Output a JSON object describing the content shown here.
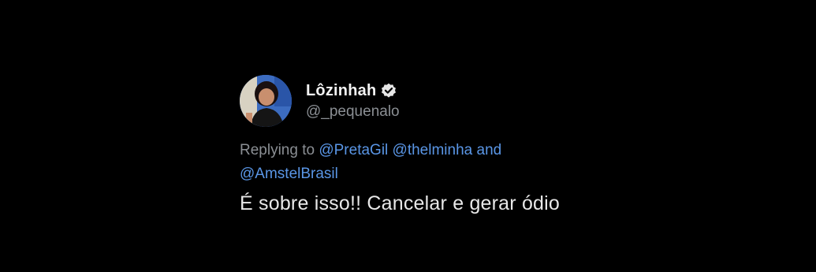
{
  "tweet": {
    "display_name": "Lôzinhah",
    "handle": "@_pequenalo",
    "verified_icon": "verified-badge-icon",
    "replying_prefix": "Replying to",
    "mentions": [
      "@PretaGil",
      "@thelminha",
      "@AmstelBrasil"
    ],
    "mention_joiner": "and",
    "text": "É sobre isso!! Cancelar e gerar ódio"
  },
  "colors": {
    "background": "#000000",
    "mention": "#5a96e6",
    "secondary_text": "#8b8f94",
    "primary_text": "#e8e8e8"
  }
}
